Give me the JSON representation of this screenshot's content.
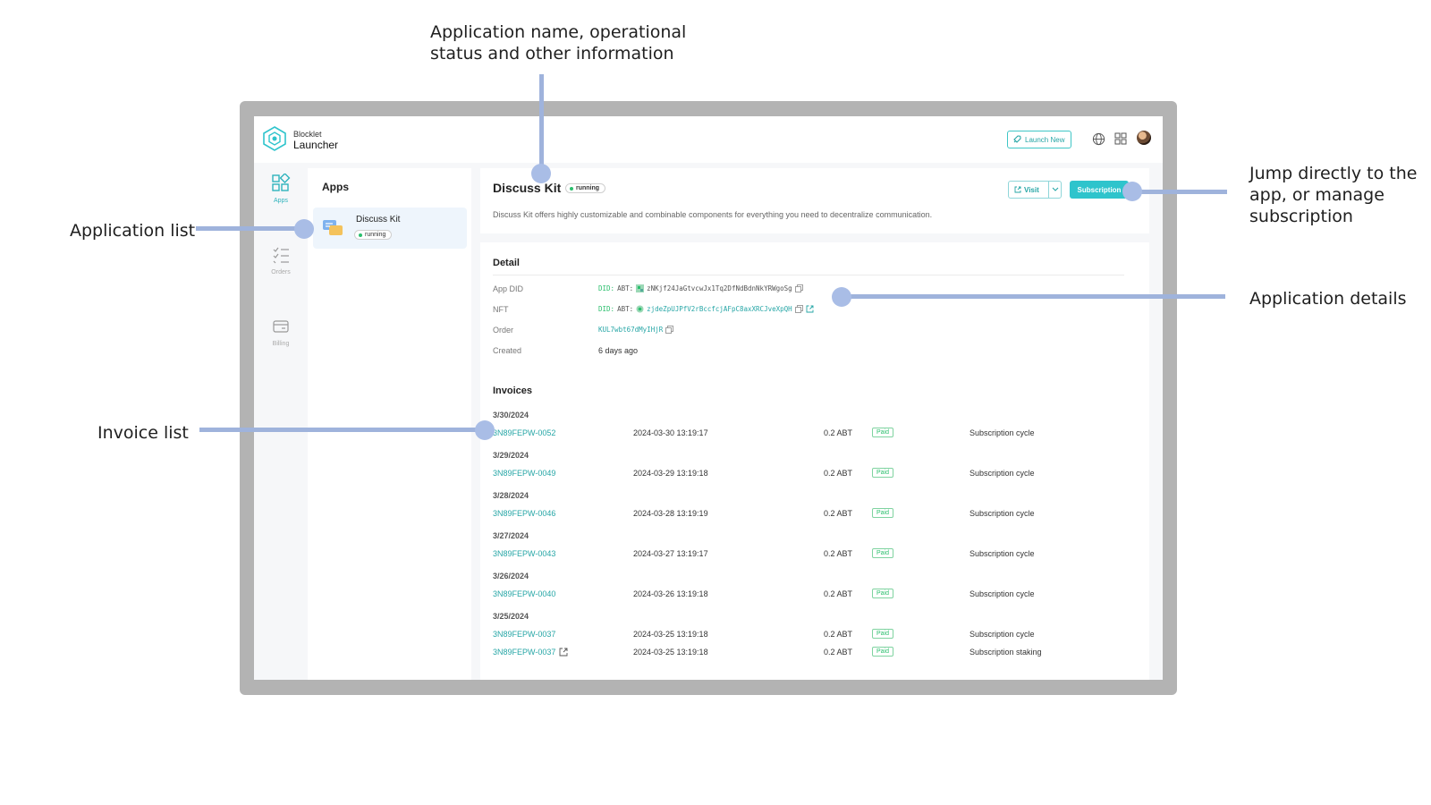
{
  "annotations": {
    "app_info": [
      "Application name, operational",
      "status and other information"
    ],
    "app_list": "Application list",
    "jump": [
      "Jump directly to the",
      "app, or manage",
      "subscription"
    ],
    "details": "Application details",
    "invoices": "Invoice list"
  },
  "brand": {
    "line1": "Blocklet",
    "line2": "Launcher"
  },
  "topbar": {
    "launch_label": "Launch New",
    "icons": [
      "globe-icon",
      "grid-icon",
      "avatar"
    ]
  },
  "sidenav": [
    {
      "label": "Apps",
      "icon": "apps-icon",
      "active": true
    },
    {
      "label": "Orders",
      "icon": "orders-icon",
      "active": false
    },
    {
      "label": "Billing",
      "icon": "billing-icon",
      "active": false
    }
  ],
  "apps_panel": {
    "title": "Apps",
    "items": [
      {
        "name": "Discuss Kit",
        "status": "running"
      }
    ]
  },
  "app": {
    "name": "Discuss Kit",
    "status": "running",
    "description": "Discuss Kit offers highly customizable and combinable components for everything you need to decentralize communication.",
    "visit_label": "Visit",
    "subscription_label": "Subscription"
  },
  "detail": {
    "title": "Detail",
    "app_did_label": "App DID",
    "app_did_prefix": "DID:",
    "app_did_abt": "ABT:",
    "app_did_value": "zNKjf24JaGtvcwJx1Tq2DfNdBdnNkYRWgoSg",
    "nft_label": "NFT",
    "nft_prefix": "DID:",
    "nft_abt": "ABT:",
    "nft_value": "zjdeZpUJPfV2rBccfcjAFpC8axXRCJveXpQH",
    "order_label": "Order",
    "order_value": "KUL7wbt67dMyIHjR",
    "created_label": "Created",
    "created_value": "6 days ago"
  },
  "invoices": {
    "title": "Invoices",
    "groups": [
      {
        "date": "3/30/2024",
        "rows": [
          {
            "number": "3N89FEPW-0052",
            "ts": "2024-03-30 13:19:17",
            "amount": "0.2 ABT",
            "status": "Paid",
            "type": "Subscription cycle",
            "ext": false
          }
        ]
      },
      {
        "date": "3/29/2024",
        "rows": [
          {
            "number": "3N89FEPW-0049",
            "ts": "2024-03-29 13:19:18",
            "amount": "0.2 ABT",
            "status": "Paid",
            "type": "Subscription cycle",
            "ext": false
          }
        ]
      },
      {
        "date": "3/28/2024",
        "rows": [
          {
            "number": "3N89FEPW-0046",
            "ts": "2024-03-28 13:19:19",
            "amount": "0.2 ABT",
            "status": "Paid",
            "type": "Subscription cycle",
            "ext": false
          }
        ]
      },
      {
        "date": "3/27/2024",
        "rows": [
          {
            "number": "3N89FEPW-0043",
            "ts": "2024-03-27 13:19:17",
            "amount": "0.2 ABT",
            "status": "Paid",
            "type": "Subscription cycle",
            "ext": false
          }
        ]
      },
      {
        "date": "3/26/2024",
        "rows": [
          {
            "number": "3N89FEPW-0040",
            "ts": "2024-03-26 13:19:18",
            "amount": "0.2 ABT",
            "status": "Paid",
            "type": "Subscription cycle",
            "ext": false
          }
        ]
      },
      {
        "date": "3/25/2024",
        "rows": [
          {
            "number": "3N89FEPW-0037",
            "ts": "2024-03-25 13:19:18",
            "amount": "0.2 ABT",
            "status": "Paid",
            "type": "Subscription cycle",
            "ext": false
          },
          {
            "number": "3N89FEPW-0037",
            "ts": "2024-03-25 13:19:18",
            "amount": "0.2 ABT",
            "status": "Paid",
            "type": "Subscription staking",
            "ext": true
          }
        ]
      }
    ]
  },
  "colors": {
    "accent": "#2ec4cc",
    "link": "#26a6a6",
    "running": "#2bbf6d",
    "callout": "#a9bde6"
  }
}
